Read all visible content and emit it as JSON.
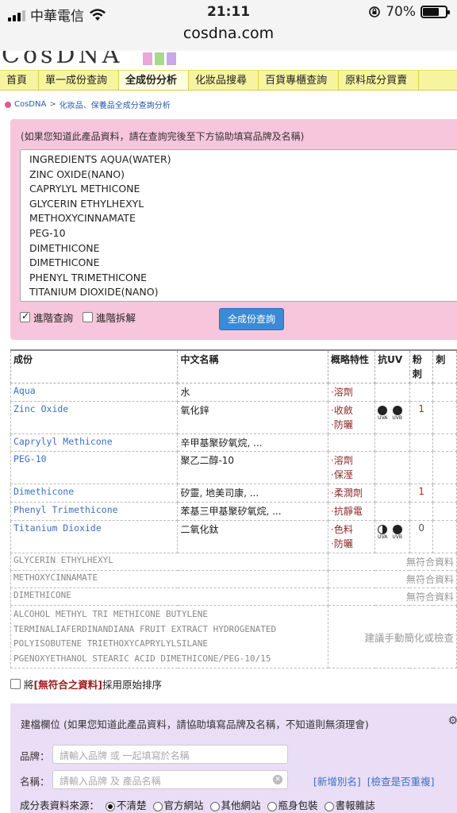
{
  "statusbar": {
    "carrier": "中華電信",
    "time": "21:11",
    "battery": "70%",
    "battery_level": 0.7,
    "url": "cosdna.com"
  },
  "nav": {
    "items": [
      {
        "label": "首頁"
      },
      {
        "label": "單一成份查詢"
      },
      {
        "label": "全成份分析"
      },
      {
        "label": "化妝品搜尋"
      },
      {
        "label": "百貨專櫃查詢"
      },
      {
        "label": "原料成分買賣"
      }
    ],
    "active_index": 2
  },
  "breadcrumb": {
    "home": "CosDNA",
    "separator": ">",
    "current": "化妝品、保養品全成分查詢分析"
  },
  "query": {
    "note": "(如果您知道此產品資料，請在查詢完後至下方協助填寫品牌及名稱)",
    "lines": [
      "INGREDIENTS AQUA(WATER)",
      "ZINC OXIDE(NANO)",
      "CAPRYLYL METHICONE",
      "GLYCERIN ETHYLHEXYL",
      "METHOXYCINNAMATE",
      "PEG-10",
      "DIMETHICONE",
      "DIMETHICONE",
      "PHENYL TRIMETHICONE",
      "TITANIUM DIOXIDE(NANO)"
    ],
    "advanced_query": "進階查詢",
    "advanced_query_checked": true,
    "advanced_split": "進階拆解",
    "advanced_split_checked": false,
    "submit": "全成份查詢"
  },
  "table": {
    "headers": [
      "成份",
      "中文名稱",
      "概略特性",
      "抗UV",
      "粉刺",
      "刺"
    ],
    "rows": [
      {
        "ingredient": "Aqua",
        "chinese": "水",
        "features": [
          "溶劑"
        ],
        "uv": [],
        "acne": ""
      },
      {
        "ingredient": "Zinc Oxide",
        "chinese": "氧化鋅",
        "features": [
          "收斂",
          "防曬"
        ],
        "uv": [
          {
            "label": "UVA",
            "fill": "full"
          },
          {
            "label": "UVB",
            "fill": "full"
          }
        ],
        "acne": "1"
      },
      {
        "ingredient": "Caprylyl Methicone",
        "chinese": "辛甲基聚矽氧烷, ...",
        "features": [],
        "uv": [],
        "acne": ""
      },
      {
        "ingredient": "PEG-10",
        "chinese": "聚乙二醇-10",
        "features": [
          "溶劑",
          "保溼"
        ],
        "uv": [],
        "acne": ""
      },
      {
        "ingredient": "Dimethicone",
        "chinese": "矽靈, 地美司康, ...",
        "features": [
          "柔潤劑"
        ],
        "uv": [],
        "acne": "1"
      },
      {
        "ingredient": "Phenyl Trimethicone",
        "chinese": "苯基三甲基聚矽氧烷, ...",
        "features": [
          "抗靜電"
        ],
        "uv": [],
        "acne": ""
      },
      {
        "ingredient": "Titanium Dioxide",
        "chinese": "二氧化鈦",
        "features": [
          "色料",
          "防曬"
        ],
        "uv": [
          {
            "label": "UVA",
            "fill": "half"
          },
          {
            "label": "UVB",
            "fill": "full"
          }
        ],
        "acne": "0"
      }
    ],
    "unmatched": [
      {
        "name": "GLYCERIN ETHYLHEXYL",
        "status": "無符合資料"
      },
      {
        "name": "METHOXYCINNAMATE",
        "status": "無符合資料"
      },
      {
        "name": "DIMETHICONE",
        "status": "無符合資料"
      }
    ],
    "long_unmatched": {
      "lines": [
        "ALCOHOL METHYL TRI METHICONE BUTYLENE",
        "TERMINALIAFERDINANDIANA FRUIT EXTRACT HYDROGENATED",
        "POLYISOBUTENE TRIETHOXYCAPRYLYLSILANE",
        "PGENOXYETHANOL STEARIC ACID DIMETHICONE/PEG-10/15"
      ],
      "status": "建議手動簡化或檢查"
    }
  },
  "sort_option": {
    "pre": "將 ",
    "highlight": "[無符合之資料]",
    "post": " 採用原始排序",
    "checked": false
  },
  "create": {
    "note": "建檔欄位 (如果您知道此產品資料，請協助填寫品牌及名稱，不知道則無須理會)",
    "brand_label": "品牌：",
    "brand_placeholder": "請輸入品牌 或 一起填寫於名稱",
    "name_label": "名稱：",
    "name_placeholder": "請輸入品牌 及 產品名稱",
    "link_add_alias": "[新增別名]",
    "link_check_duplicate": "[檢查是否重複]",
    "source_label": "成分表資料來源：",
    "sources": [
      {
        "label": "不清楚",
        "checked": true
      },
      {
        "label": "官方網站",
        "checked": false
      },
      {
        "label": "其他網站",
        "checked": false
      },
      {
        "label": "瓶身包裝",
        "checked": false
      },
      {
        "label": "書報雜誌",
        "checked": false
      }
    ]
  },
  "colors": {
    "nav_bg": "#f7f4a0",
    "query_bg": "#f7c6dc",
    "create_bg": "#e9def5",
    "link": "#3b6fc4",
    "button": "#3b8ad6",
    "feature": "#8c2a2a",
    "acne_red": "#d02020"
  }
}
